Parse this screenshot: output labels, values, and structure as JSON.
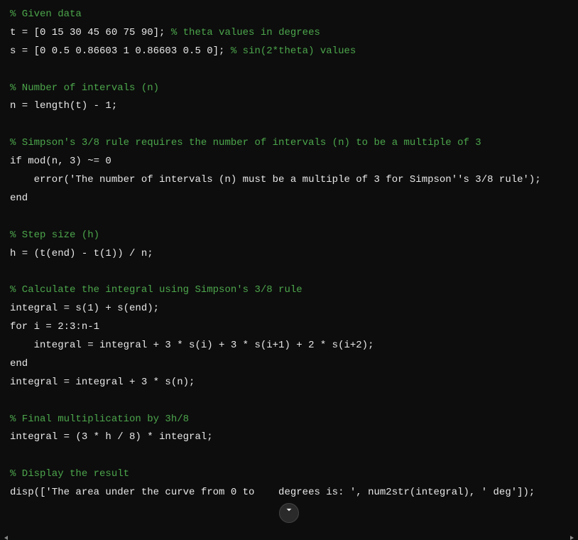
{
  "lines": [
    {
      "type": "comment",
      "text": "% Given data"
    },
    {
      "type": "mixed",
      "parts": [
        {
          "t": "normal",
          "v": "t = [0 15 30 45 60 75 90]; "
        },
        {
          "t": "comment",
          "v": "% theta values in degrees"
        }
      ]
    },
    {
      "type": "mixed",
      "parts": [
        {
          "t": "normal",
          "v": "s = [0 0.5 0.86603 1 0.86603 0.5 0]; "
        },
        {
          "t": "comment",
          "v": "% sin(2*theta) values"
        }
      ]
    },
    {
      "type": "blank",
      "text": ""
    },
    {
      "type": "comment",
      "text": "% Number of intervals (n)"
    },
    {
      "type": "normal",
      "text": "n = length(t) - 1;"
    },
    {
      "type": "blank",
      "text": ""
    },
    {
      "type": "comment",
      "text": "% Simpson's 3/8 rule requires the number of intervals (n) to be a multiple of 3"
    },
    {
      "type": "normal",
      "text": "if mod(n, 3) ~= 0"
    },
    {
      "type": "normal",
      "text": "    error('The number of intervals (n) must be a multiple of 3 for Simpson''s 3/8 rule');"
    },
    {
      "type": "normal",
      "text": "end"
    },
    {
      "type": "blank",
      "text": ""
    },
    {
      "type": "comment",
      "text": "% Step size (h)"
    },
    {
      "type": "normal",
      "text": "h = (t(end) - t(1)) / n;"
    },
    {
      "type": "blank",
      "text": ""
    },
    {
      "type": "comment",
      "text": "% Calculate the integral using Simpson's 3/8 rule"
    },
    {
      "type": "normal",
      "text": "integral = s(1) + s(end);"
    },
    {
      "type": "normal",
      "text": "for i = 2:3:n-1"
    },
    {
      "type": "normal",
      "text": "    integral = integral + 3 * s(i) + 3 * s(i+1) + 2 * s(i+2);"
    },
    {
      "type": "normal",
      "text": "end"
    },
    {
      "type": "normal",
      "text": "integral = integral + 3 * s(n);"
    },
    {
      "type": "blank",
      "text": ""
    },
    {
      "type": "comment",
      "text": "% Final multiplication by 3h/8"
    },
    {
      "type": "normal",
      "text": "integral = (3 * h / 8) * integral;"
    },
    {
      "type": "blank",
      "text": ""
    },
    {
      "type": "comment",
      "text": "% Display the result"
    },
    {
      "type": "normal",
      "text": "disp(['The area under the curve from 0 to    degrees is: ', num2str(integral), ' deg']);"
    }
  ],
  "scroll_button_label": "Scroll down"
}
